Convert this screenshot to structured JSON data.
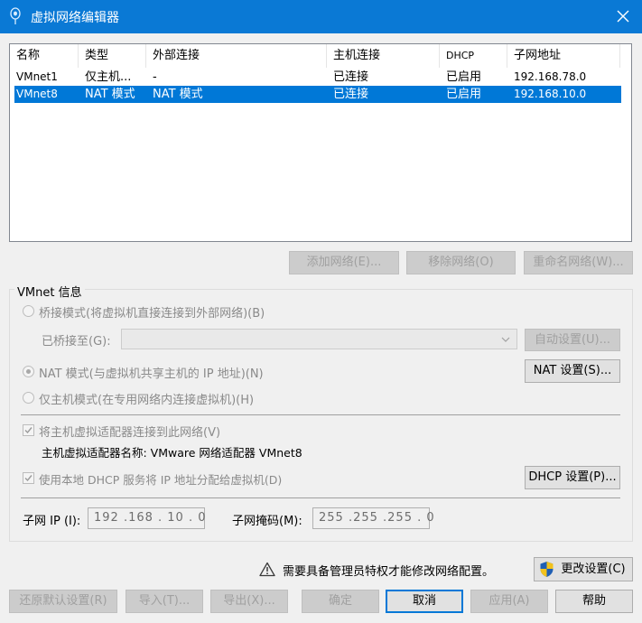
{
  "window": {
    "title": "虚拟网络编辑器"
  },
  "network_list": {
    "columns": [
      "名称",
      "类型",
      "外部连接",
      "主机连接",
      "DHCP",
      "子网地址"
    ],
    "rows": [
      {
        "name": "VMnet1",
        "type": "仅主机...",
        "external": "-",
        "host": "已连接",
        "dhcp": "已启用",
        "subnet": "192.168.78.0",
        "selected": false
      },
      {
        "name": "VMnet8",
        "type": "NAT 模式",
        "external": "NAT 模式",
        "host": "已连接",
        "dhcp": "已启用",
        "subnet": "192.168.10.0",
        "selected": true
      }
    ]
  },
  "list_buttons": {
    "add": "添加网络(E)...",
    "remove": "移除网络(O)",
    "rename": "重命名网络(W)..."
  },
  "vmnet_info": {
    "legend": "VMnet 信息",
    "bridged_label": "桥接模式(将虚拟机直接连接到外部网络)(B)",
    "bridged_to_label": "已桥接至(G):",
    "bridged_to_value": "",
    "auto_settings": "自动设置(U)...",
    "nat_label": "NAT 模式(与虚拟机共享主机的 IP 地址)(N)",
    "nat_settings": "NAT 设置(S)...",
    "hostonly_label": "仅主机模式(在专用网络内连接虚拟机)(H)",
    "connect_adapter_label": "将主机虚拟适配器连接到此网络(V)",
    "adapter_name_label": "主机虚拟适配器名称: VMware 网络适配器 VMnet8",
    "dhcp_label": "使用本地 DHCP 服务将 IP 地址分配给虚拟机(D)",
    "dhcp_settings": "DHCP 设置(P)...",
    "subnet_ip_label": "子网 IP (I):",
    "subnet_ip_value": "192 .168 . 10 .  0",
    "subnet_mask_label": "子网掩码(M):",
    "subnet_mask_value": "255 .255 .255 .  0",
    "selected_mode": "nat",
    "connect_adapter_checked": true,
    "dhcp_checked": true
  },
  "admin_notice": {
    "text": "需要具备管理员特权才能修改网络配置。",
    "change_settings": "更改设置(C)"
  },
  "footer_buttons": {
    "restore_defaults": "还原默认设置(R)",
    "import": "导入(T)...",
    "export": "导出(X)...",
    "ok": "确定",
    "cancel": "取消",
    "apply": "应用(A)",
    "help": "帮助"
  },
  "colors": {
    "titlebar": "#0a79d5",
    "selection": "#0078d7",
    "disabled_text": "#a0a0a0",
    "shield_blue": "#1f5fb4",
    "shield_yellow": "#f2c21b"
  },
  "icons": {
    "app": "network-editor-icon",
    "close": "close-icon",
    "dropdown": "chevron-down-icon",
    "warning": "warning-icon",
    "shield": "uac-shield-icon"
  }
}
